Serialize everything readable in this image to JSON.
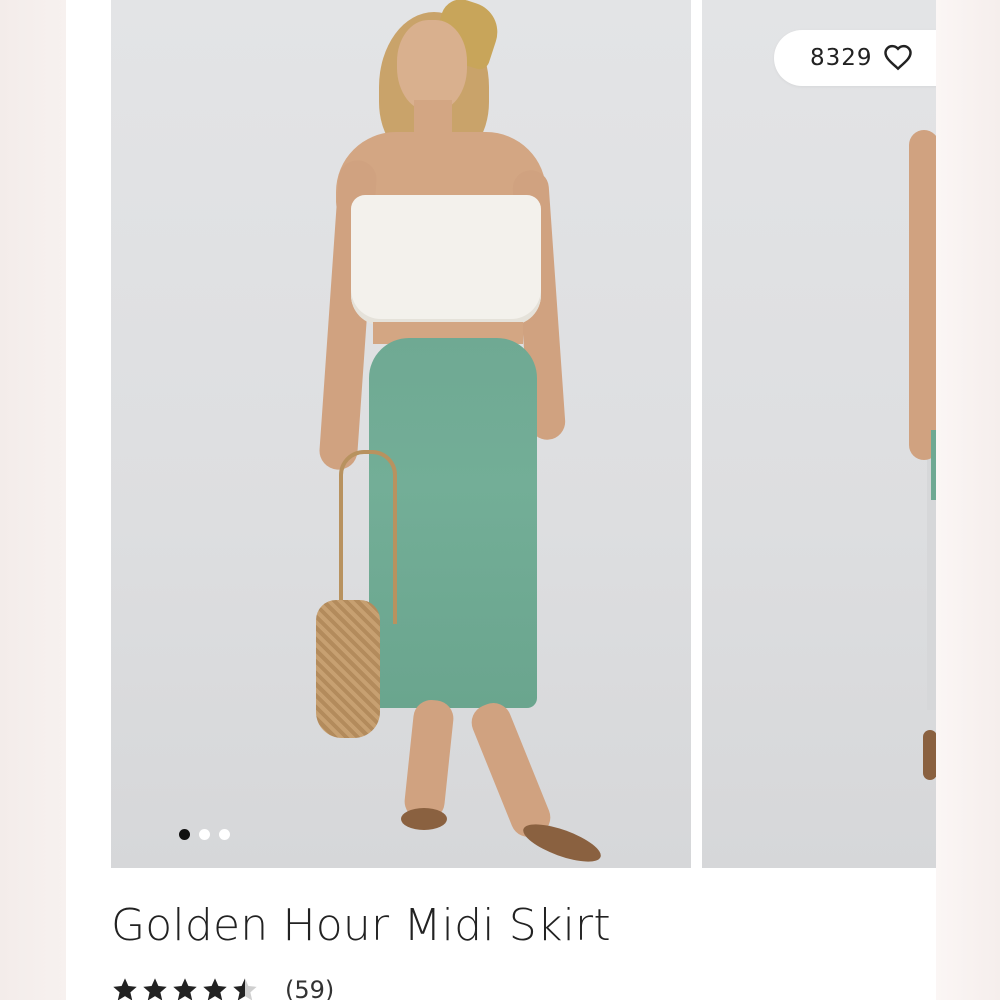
{
  "gallery": {
    "likes_count": "8329",
    "dots": {
      "total": 3,
      "active_index": 0
    }
  },
  "product": {
    "title": "Golden Hour Midi Skirt",
    "rating": {
      "stars": 4.5,
      "out_of": 5,
      "review_count_text": "(59)"
    }
  },
  "icons": {
    "like": "heart-outline-icon",
    "star": "star-icon"
  },
  "colors": {
    "dot_active": "#111111",
    "dot_inactive": "#ffffff",
    "star": "#222222",
    "star_empty": "#cfcfcf"
  }
}
